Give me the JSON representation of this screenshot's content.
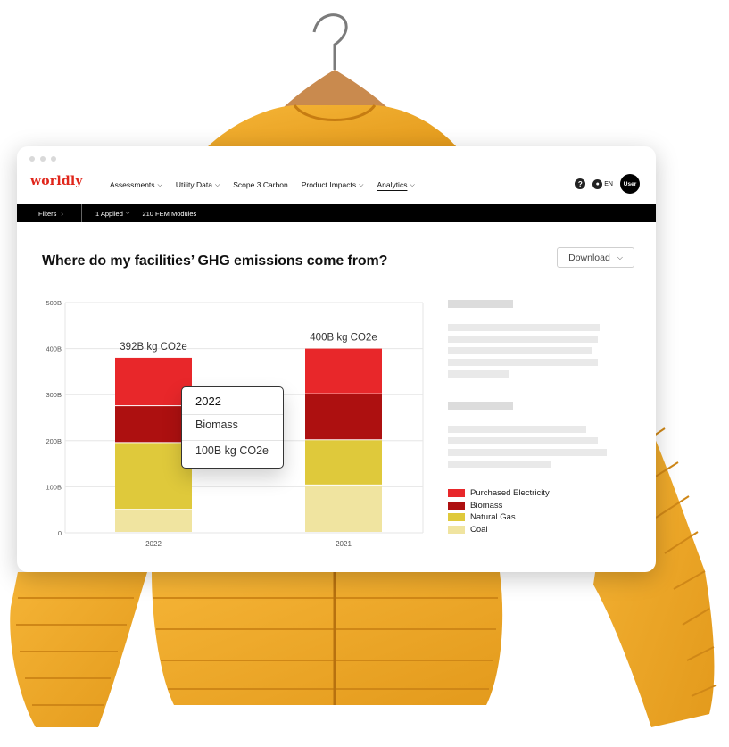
{
  "brand": {
    "logo": "worldly",
    "color": "#e0261b"
  },
  "nav": {
    "items": [
      {
        "label": "Assessments",
        "dropdown": true,
        "active": false
      },
      {
        "label": "Utility Data",
        "dropdown": true,
        "active": false
      },
      {
        "label": "Scope 3 Carbon",
        "dropdown": false,
        "active": false
      },
      {
        "label": "Product Impacts",
        "dropdown": true,
        "active": false
      },
      {
        "label": "Analytics",
        "dropdown": true,
        "active": true
      }
    ],
    "help_icon": "question-icon",
    "language": "EN",
    "language_icon": "globe-icon",
    "avatar": "User"
  },
  "filter_bar": {
    "filters_label": "Filters",
    "applied_label": "1 Applied",
    "modules_label": "210 FEM Modules"
  },
  "page": {
    "title": "Where do my facilities’ GHG emissions come from?",
    "download_label": "Download"
  },
  "tooltip": {
    "year": "2022",
    "series": "Biomass",
    "value": "100B kg CO2e"
  },
  "chart_data": {
    "type": "bar",
    "stacked": true,
    "categories": [
      "2022",
      "2021"
    ],
    "totals_labels": [
      "392B kg CO2e",
      "400B kg CO2e"
    ],
    "yticks": [
      "500B",
      "400B",
      "300B",
      "200B",
      "100B",
      "0"
    ],
    "ylim": [
      0,
      500
    ],
    "grid": true,
    "legend_position": "right",
    "series": [
      {
        "name": "Coal",
        "color": "#f0e4a0",
        "values": [
          50,
          103
        ]
      },
      {
        "name": "Natural Gas",
        "color": "#dfc93b",
        "values": [
          145,
          98
        ]
      },
      {
        "name": "Biomass",
        "color": "#ad1010",
        "values": [
          80,
          100
        ]
      },
      {
        "name": "Purchased Electricity",
        "color": "#e8272a",
        "values": [
          105,
          99
        ]
      }
    ],
    "legend_order": [
      "Purchased Electricity",
      "Biomass",
      "Natural Gas",
      "Coal"
    ]
  }
}
